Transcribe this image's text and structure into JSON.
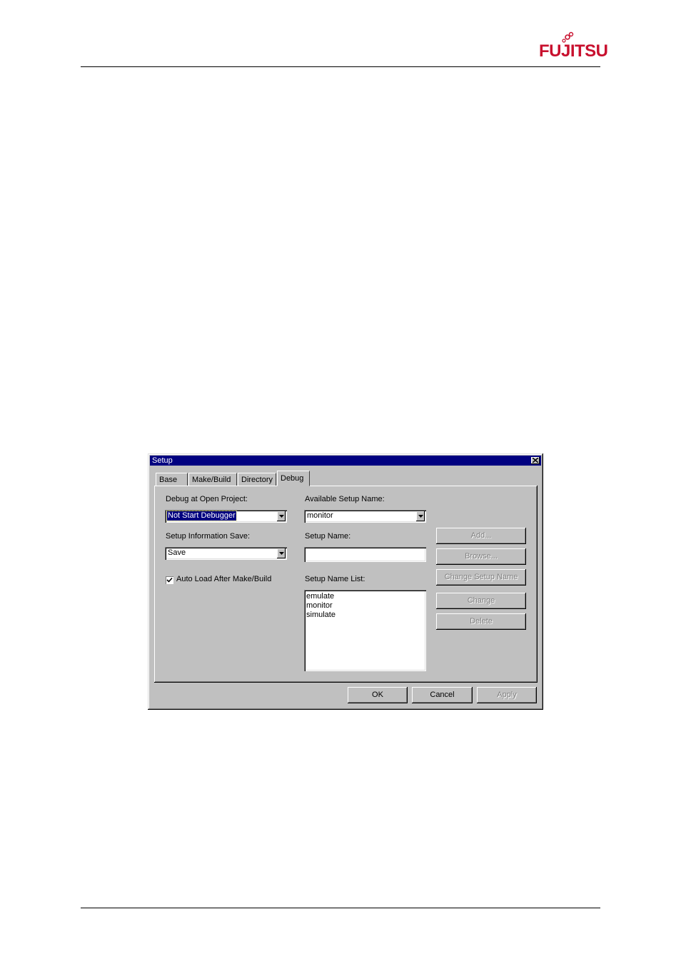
{
  "page": {
    "logo_text": "FUJITSU"
  },
  "dialog": {
    "title": "Setup",
    "tabs": [
      {
        "label": "Base",
        "active": false
      },
      {
        "label": "Make/Build",
        "active": false
      },
      {
        "label": "Directory",
        "active": false
      },
      {
        "label": "Debug",
        "active": true
      }
    ],
    "debug_at_open_project": {
      "label": "Debug at Open Project:",
      "value": "Not Start Debugger"
    },
    "setup_information_save": {
      "label": "Setup Information Save:",
      "value": "Save"
    },
    "auto_load": {
      "label": "Auto Load After Make/Build",
      "checked": true
    },
    "available_setup_name": {
      "label": "Available Setup Name:",
      "value": "monitor"
    },
    "setup_name": {
      "label": "Setup Name:",
      "value": ""
    },
    "setup_name_list": {
      "label": "Setup Name List:",
      "items": [
        "emulate",
        "monitor",
        "simulate"
      ]
    },
    "side_buttons": {
      "add": "Add...",
      "browse": "Browse...",
      "change_setup_name": "Change Setup Name",
      "change": "Change",
      "delete": "Delete"
    },
    "footer_buttons": {
      "ok": "OK",
      "cancel": "Cancel",
      "apply": "Apply"
    }
  }
}
